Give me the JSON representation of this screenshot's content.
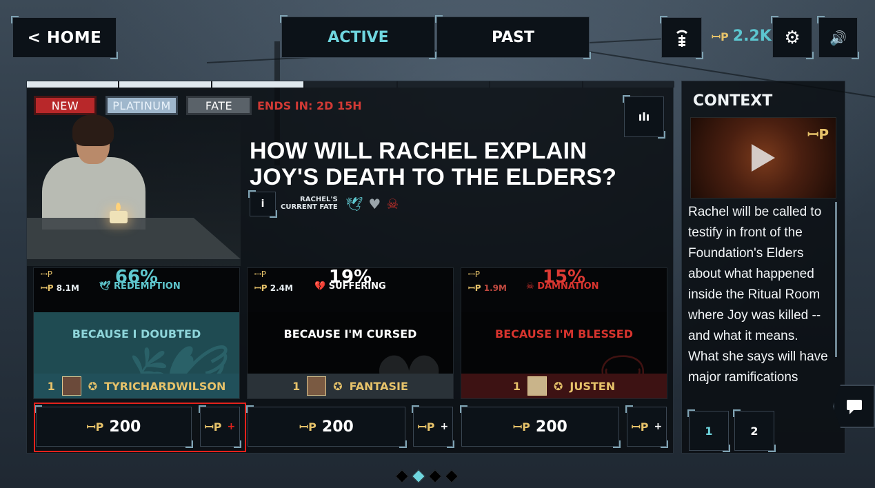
{
  "nav": {
    "home_label": "< HOME",
    "tab_active": "ACTIVE",
    "tab_past": "PAST",
    "points_icon": "ꟷP",
    "points_value": "2.2K",
    "stats_icon": "stats-icon",
    "gear_icon": "⚙",
    "sound_icon": "🔊"
  },
  "progress_segments": [
    true,
    true,
    true,
    false,
    false,
    false,
    false
  ],
  "tags": {
    "new": "NEW",
    "platinum": "PLATINUM",
    "fate": "FATE",
    "ends_in": "ENDS IN: 2D 15H"
  },
  "question": {
    "title": "HOW WILL RACHEL EXPLAIN JOY'S DEATH TO THE ELDERS?",
    "info_label": "i",
    "fate_label_line1": "RACHEL'S",
    "fate_label_line2": "CURRENT FATE",
    "chart_icon": "ılı"
  },
  "choices": [
    {
      "percent": "66%",
      "count": "8.1M",
      "fate": "REDEMPTION",
      "fate_icon": "🕊",
      "answer": "BECAUSE I DOUBTED",
      "rank": "1",
      "user": "TYRICHARDWILSON",
      "wager": "200"
    },
    {
      "percent": "19%",
      "count": "2.4M",
      "fate": "SUFFERING",
      "fate_icon": "💔",
      "answer": "BECAUSE I'M CURSED",
      "rank": "1",
      "user": "FANTASIE",
      "wager": "200"
    },
    {
      "percent": "15%",
      "count": "1.9M",
      "fate": "DAMNATION",
      "fate_icon": "☠",
      "answer": "BECAUSE I'M BLESSED",
      "rank": "1",
      "user": "JUSTEN",
      "wager": "200"
    }
  ],
  "wager_plus": "+",
  "context": {
    "title": "CONTEXT",
    "video_badge": "ꟷP",
    "text": "Rachel will be called to testify in front of the Foundation's Elders about what happened inside the Ritual Room where Joy was killed -- and what it means. What she says will have major ramifications",
    "pages": [
      "1",
      "2"
    ]
  },
  "pager_dots": [
    false,
    true,
    false,
    false
  ],
  "colors": {
    "accent": "#6fd6df",
    "points_gold": "#e6c26a",
    "new_red": "#b8282a",
    "redemption": "#5fc8cf",
    "damnation": "#d8342e",
    "selection": "#e4221c"
  }
}
